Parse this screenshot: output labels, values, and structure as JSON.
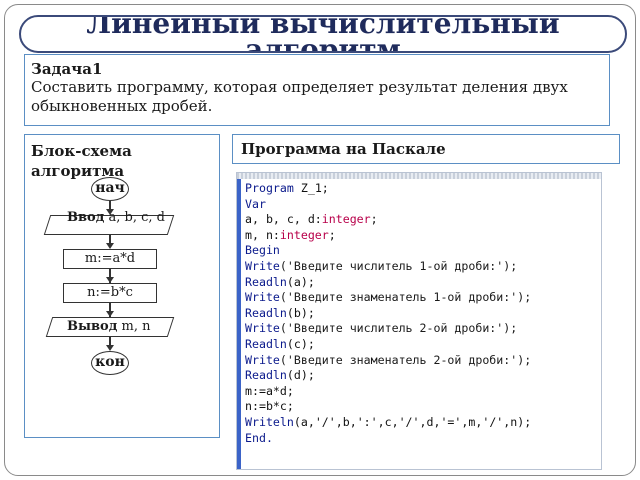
{
  "title": "Линейный вычислительный алгоритм",
  "task": {
    "title": "Задача1",
    "text": "Составить программу, которая определяет результат деления двух обыкновенных дробей."
  },
  "flowchart": {
    "title": "Блок-схема алгоритма",
    "start": "нач",
    "input_keyword": "Ввод",
    "input_vars": "a, b, c, d",
    "step1": "m:=a*d",
    "step2": "n:=b*c",
    "output_keyword": "Вывод",
    "output_vars": "m, n",
    "end": "кон"
  },
  "pascal": {
    "title": "Программа на Паскале",
    "code": [
      [
        {
          "t": "Program",
          "c": "kw"
        },
        {
          "t": " Z_1;",
          "c": "id"
        }
      ],
      [
        {
          "t": "Var",
          "c": "kw"
        }
      ],
      [
        {
          "t": "a, b, c, d:",
          "c": "id"
        },
        {
          "t": "integer",
          "c": "ty"
        },
        {
          "t": ";",
          "c": "id"
        }
      ],
      [
        {
          "t": "m, n:",
          "c": "id"
        },
        {
          "t": "integer",
          "c": "ty"
        },
        {
          "t": ";",
          "c": "id"
        }
      ],
      [
        {
          "t": "Begin",
          "c": "kw"
        }
      ],
      [
        {
          "t": "Write",
          "c": "kw"
        },
        {
          "t": "('Введите числитель 1-ой дроби:');",
          "c": "st"
        }
      ],
      [
        {
          "t": "Readln",
          "c": "kw"
        },
        {
          "t": "(a);",
          "c": "id"
        }
      ],
      [
        {
          "t": "Write",
          "c": "kw"
        },
        {
          "t": "('Введите знаменатель 1-ой дроби:');",
          "c": "st"
        }
      ],
      [
        {
          "t": "Readln",
          "c": "kw"
        },
        {
          "t": "(b);",
          "c": "id"
        }
      ],
      [
        {
          "t": "Write",
          "c": "kw"
        },
        {
          "t": "('Введите числитель 2-ой дроби:');",
          "c": "st"
        }
      ],
      [
        {
          "t": "Readln",
          "c": "kw"
        },
        {
          "t": "(c);",
          "c": "id"
        }
      ],
      [
        {
          "t": "Write",
          "c": "kw"
        },
        {
          "t": "('Введите знаменатель 2-ой дроби:');",
          "c": "st"
        }
      ],
      [
        {
          "t": "Readln",
          "c": "kw"
        },
        {
          "t": "(d);",
          "c": "id"
        }
      ],
      [
        {
          "t": "m:=a*d;",
          "c": "id"
        }
      ],
      [
        {
          "t": "n:=b*c;",
          "c": "id"
        }
      ],
      [
        {
          "t": "Writeln",
          "c": "kw"
        },
        {
          "t": "(a,'/',b,':',c,'/',d,'=',m,'/',n);",
          "c": "id"
        }
      ],
      [
        {
          "t": "End.",
          "c": "kw"
        }
      ]
    ]
  }
}
